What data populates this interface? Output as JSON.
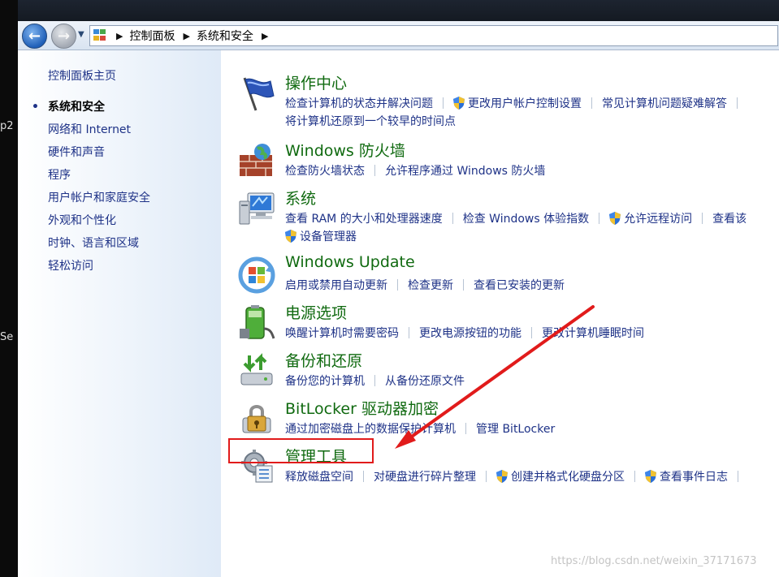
{
  "desktop": {
    "fragments": [
      "p2",
      "Se"
    ]
  },
  "addressbar": {
    "breadcrumbs": [
      "控制面板",
      "系统和安全"
    ]
  },
  "sidebar": {
    "home_label": "控制面板主页",
    "items": [
      {
        "label": "系统和安全",
        "current": true
      },
      {
        "label": "网络和 Internet"
      },
      {
        "label": "硬件和声音"
      },
      {
        "label": "程序"
      },
      {
        "label": "用户帐户和家庭安全"
      },
      {
        "label": "外观和个性化"
      },
      {
        "label": "时钟、语言和区域"
      },
      {
        "label": "轻松访问"
      }
    ]
  },
  "categories": [
    {
      "title": "操作中心",
      "icon": "flag-icon",
      "rows": [
        [
          "检查计算机的状态并解决问题",
          "更改用户帐户控制设置",
          "常见计算机问题疑难解答"
        ],
        [
          "将计算机还原到一个较早的时间点"
        ]
      ]
    },
    {
      "title": "Windows 防火墙",
      "icon": "firewall-icon",
      "rows": [
        [
          "检查防火墙状态",
          "允许程序通过 Windows 防火墙"
        ]
      ]
    },
    {
      "title": "系统",
      "icon": "computer-icon",
      "rows": [
        [
          "查看 RAM 的大小和处理器速度",
          "检查 Windows 体验指数",
          "允许远程访问",
          "查看该"
        ],
        [
          "设备管理器"
        ]
      ]
    },
    {
      "title": "Windows Update",
      "icon": "windows-update-icon",
      "rows": [
        [
          "启用或禁用自动更新",
          "检查更新",
          "查看已安装的更新"
        ]
      ]
    },
    {
      "title": "电源选项",
      "icon": "battery-icon",
      "rows": [
        [
          "唤醒计算机时需要密码",
          "更改电源按钮的功能",
          "更改计算机睡眠时间"
        ]
      ]
    },
    {
      "title": "备份和还原",
      "icon": "backup-icon",
      "rows": [
        [
          "备份您的计算机",
          "从备份还原文件"
        ]
      ]
    },
    {
      "title": "BitLocker 驱动器加密",
      "icon": "bitlocker-icon",
      "rows": [
        [
          "通过加密磁盘上的数据保护计算机",
          "管理 BitLocker"
        ]
      ]
    },
    {
      "title": "管理工具",
      "icon": "admin-tools-icon",
      "rows": [
        [
          "释放磁盘空间",
          "对硬盘进行碎片整理",
          "创建并格式化硬盘分区",
          "查看事件日志"
        ]
      ]
    }
  ],
  "watermark": "https://blog.csdn.net/weixin_37171673",
  "colors": {
    "link": "#1e3287",
    "category_title": "#106a10",
    "highlight": "#e11b1b"
  }
}
